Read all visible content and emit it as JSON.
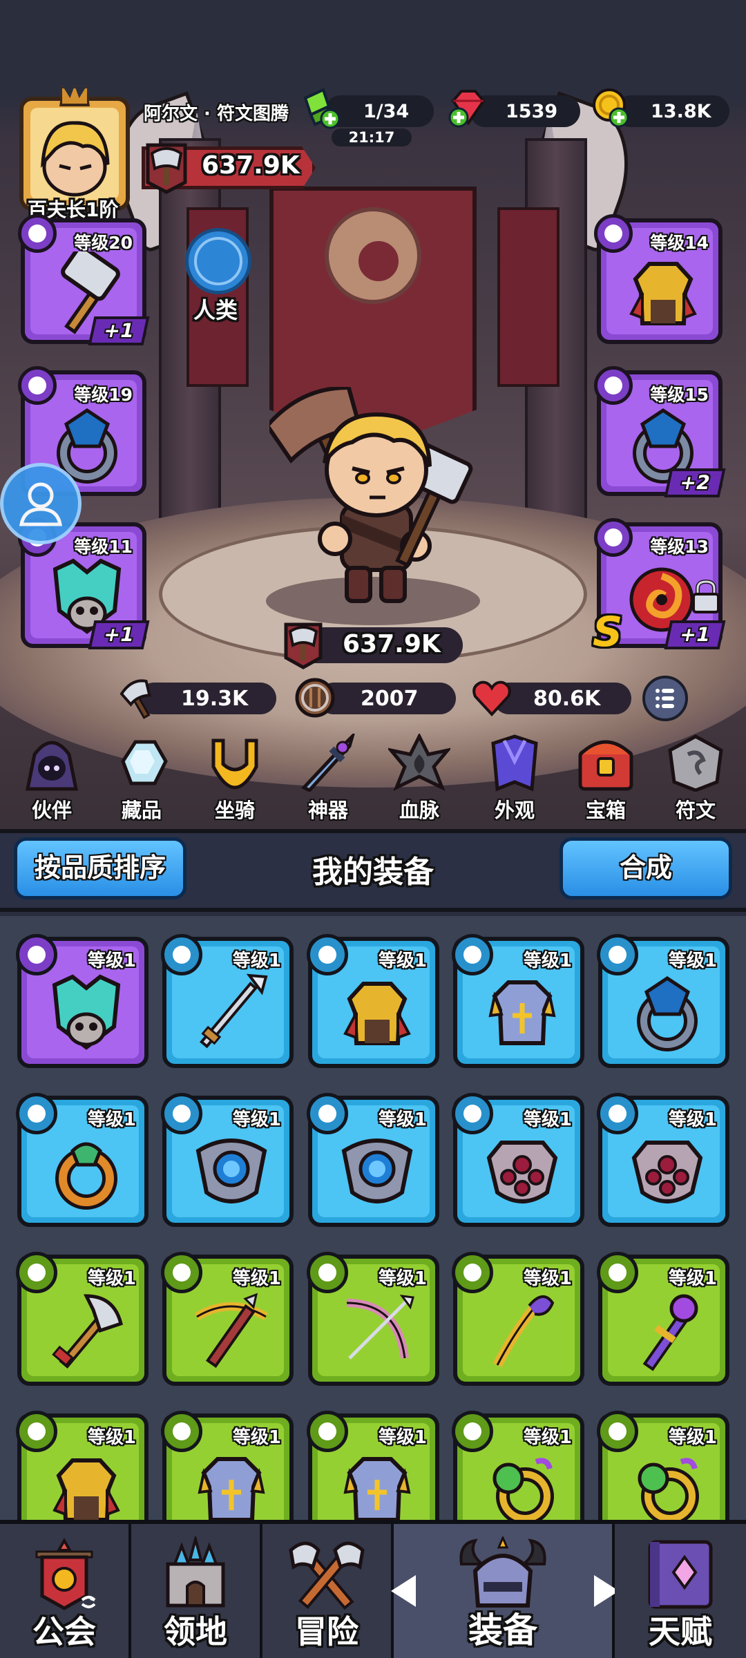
{
  "header": {
    "player_name": "阿尔文 · 符文图腾",
    "rank": "百夫长1阶",
    "power": "637.9K",
    "energy": "1/34",
    "energy_timer": "21:17",
    "gems": "1539",
    "gold": "13.8K"
  },
  "race": {
    "label": "人类"
  },
  "equipped": {
    "weapon": {
      "level": "等级20",
      "bonus": "+1"
    },
    "armor": {
      "level": "等级14"
    },
    "ring_left": {
      "level": "等级19"
    },
    "ring_right": {
      "level": "等级15",
      "bonus": "+2"
    },
    "helmet": {
      "level": "等级11",
      "bonus": "+1"
    },
    "necklace": {
      "level": "等级13",
      "bonus": "+1",
      "rank": "S"
    }
  },
  "hero_stats": {
    "power": "637.9K",
    "attack": "19.3K",
    "defense": "2007",
    "health": "80.6K"
  },
  "features": [
    {
      "label": "伙伴",
      "icon": "partner-icon"
    },
    {
      "label": "藏品",
      "icon": "collection-icon"
    },
    {
      "label": "坐骑",
      "icon": "mount-icon"
    },
    {
      "label": "神器",
      "icon": "artifact-icon"
    },
    {
      "label": "血脉",
      "icon": "bloodline-icon"
    },
    {
      "label": "外观",
      "icon": "appearance-icon"
    },
    {
      "label": "宝箱",
      "icon": "chest-icon"
    },
    {
      "label": "符文",
      "icon": "rune-icon"
    }
  ],
  "inventory": {
    "sort_label": "按品质排序",
    "title": "我的装备",
    "merge_label": "合成",
    "items": [
      {
        "level": "等级1",
        "quality": "purple",
        "art": "helmet"
      },
      {
        "level": "等级1",
        "quality": "blue",
        "art": "spear"
      },
      {
        "level": "等级1",
        "quality": "blue",
        "art": "armor-gold"
      },
      {
        "level": "等级1",
        "quality": "blue",
        "art": "armor-silver"
      },
      {
        "level": "等级1",
        "quality": "blue",
        "art": "ring-dark"
      },
      {
        "level": "等级1",
        "quality": "blue",
        "art": "ring-gold"
      },
      {
        "level": "等级1",
        "quality": "blue",
        "art": "amulet-blue"
      },
      {
        "level": "等级1",
        "quality": "blue",
        "art": "amulet-blue"
      },
      {
        "level": "等级1",
        "quality": "blue",
        "art": "amulet-pink"
      },
      {
        "level": "等级1",
        "quality": "blue",
        "art": "amulet-pink"
      },
      {
        "level": "等级1",
        "quality": "green",
        "art": "axe"
      },
      {
        "level": "等级1",
        "quality": "green",
        "art": "crossbow"
      },
      {
        "level": "等级1",
        "quality": "green",
        "art": "bow"
      },
      {
        "level": "等级1",
        "quality": "green",
        "art": "staff"
      },
      {
        "level": "等级1",
        "quality": "green",
        "art": "scepter"
      },
      {
        "level": "等级1",
        "quality": "green",
        "art": "armor-gold"
      },
      {
        "level": "等级1",
        "quality": "green",
        "art": "armor-silver"
      },
      {
        "level": "等级1",
        "quality": "green",
        "art": "armor-silver"
      },
      {
        "level": "等级1",
        "quality": "green",
        "art": "ring-green"
      },
      {
        "level": "等级1",
        "quality": "green",
        "art": "ring-green"
      }
    ]
  },
  "bottom_nav": [
    {
      "label": "公会",
      "icon": "guild-icon"
    },
    {
      "label": "领地",
      "icon": "territory-icon"
    },
    {
      "label": "冒险",
      "icon": "adventure-icon"
    },
    {
      "label": "装备",
      "icon": "equipment-icon"
    },
    {
      "label": "天赋",
      "icon": "talent-icon"
    }
  ],
  "colors": {
    "purple": "#a965ee",
    "blue": "#4cc4f4",
    "green": "#95d033",
    "accent_blue": "#2a8fe6",
    "power_red": "#b8323a"
  }
}
